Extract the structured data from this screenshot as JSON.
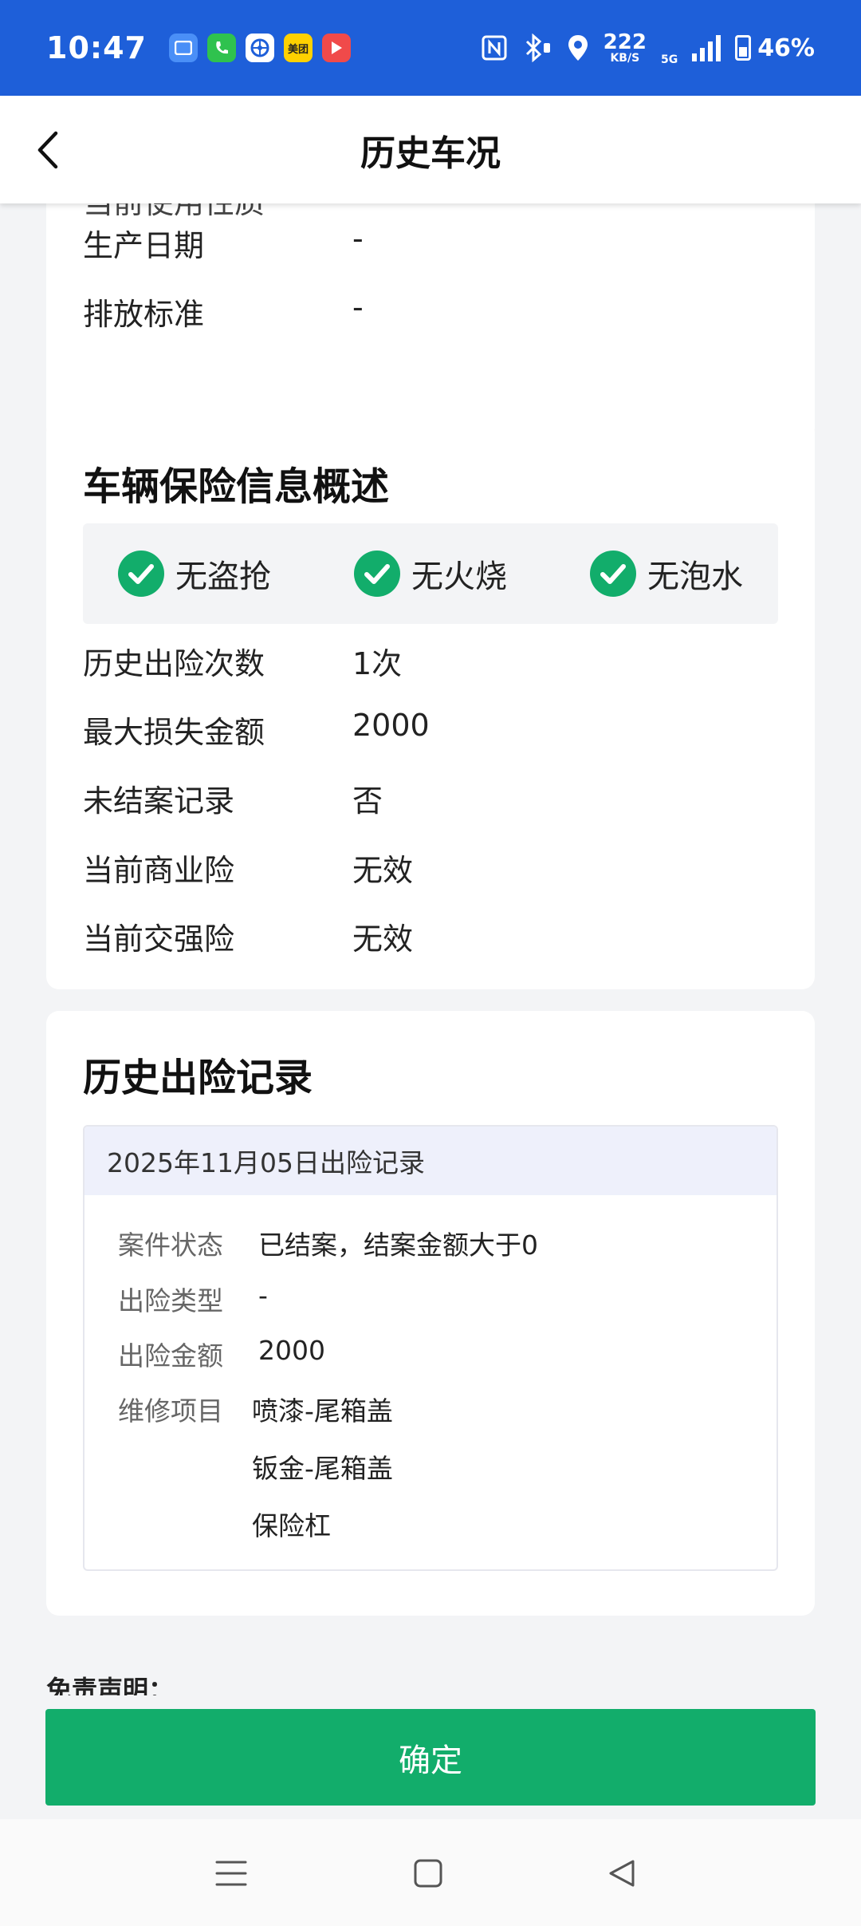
{
  "status_bar": {
    "time": "10:47",
    "apps": [
      {
        "name": "notes-app-icon",
        "color": "#4a8ff7",
        "glyph": ""
      },
      {
        "name": "phone-app-icon",
        "color": "#2fc24e",
        "glyph": ""
      },
      {
        "name": "wheel-app-icon",
        "color": "#ffffff",
        "glyph": ""
      },
      {
        "name": "meituan-app-icon",
        "color": "#ffd100",
        "glyph": "美团"
      },
      {
        "name": "video-app-icon",
        "color": "#f04a4a",
        "glyph": ""
      }
    ],
    "net_speed_value": "222",
    "net_speed_unit": "KB/S",
    "network": "5G",
    "battery": "46%"
  },
  "nav": {
    "title": "历史车况"
  },
  "vehicle_info": {
    "rows": [
      {
        "key": "当前使用性质",
        "value": "-"
      },
      {
        "key": "生产日期",
        "value": "-"
      },
      {
        "key": "排放标准",
        "value": "-"
      }
    ]
  },
  "insurance_overview": {
    "title": "车辆保险信息概述",
    "checks": [
      "无盗抢",
      "无火烧",
      "无泡水"
    ],
    "rows": [
      {
        "key": "历史出险次数",
        "value": "1次"
      },
      {
        "key": "最大损失金额",
        "value": "2000"
      },
      {
        "key": "未结案记录",
        "value": "否"
      },
      {
        "key": "当前商业险",
        "value": "无效"
      },
      {
        "key": "当前交强险",
        "value": "无效"
      }
    ]
  },
  "claim_history": {
    "title": "历史出险记录",
    "record": {
      "header": "2025年11月05日出险记录",
      "status_label": "案件状态",
      "status_value": "已结案，结案金额大于0",
      "type_label": "出险类型",
      "type_value": "-",
      "amount_label": "出险金额",
      "amount_value": "2000",
      "repair_label": "维修项目",
      "repair_items": [
        "喷漆-尾箱盖",
        "钣金-尾箱盖",
        "保险杠"
      ]
    }
  },
  "disclaimer": "免责声明：",
  "confirm_label": "确定",
  "colors": {
    "status_bar": "#1e5fd9",
    "accent_green": "#12ad6b",
    "record_header": "#eef0fb"
  }
}
